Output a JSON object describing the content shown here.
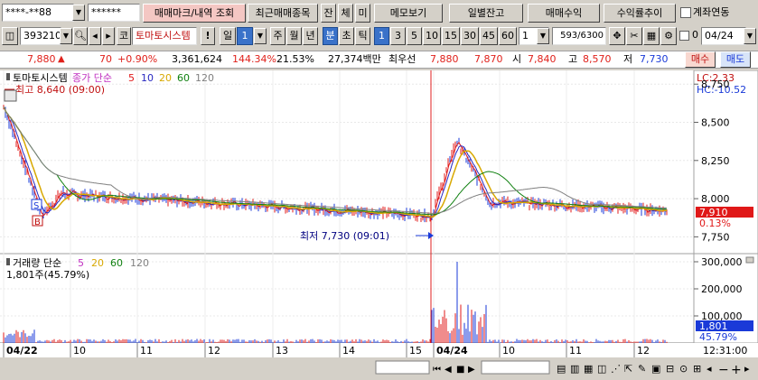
{
  "toolbar": {
    "account": "****-**88",
    "password": "******",
    "btn_order_history": "매매마크/내역 조회",
    "btn_recent_stocks": "최근매매종목",
    "btn_balance": "잔",
    "btn_execution": "체",
    "btn_unfilled": "미",
    "btn_memo": "메모보기",
    "btn_daily_balance": "일별잔고",
    "btn_trade_profit": "매매수익",
    "btn_return_trend": "수익률추이",
    "check_account_link": "계좌연동"
  },
  "chart_toolbar": {
    "code": "393210",
    "market_label": "코",
    "stock_name": "토마토시스템",
    "bang": "!",
    "period_day": "일",
    "period_value": "1",
    "week": "주",
    "month": "월",
    "year": "년",
    "minute": "분",
    "second": "초",
    "tick": "틱",
    "intervals": [
      "1",
      "3",
      "5",
      "10",
      "15",
      "30",
      "45",
      "60"
    ],
    "interval_input": "1",
    "count": "593",
    "count_total": "/6300",
    "checkbox_label": "0",
    "date": "04/24"
  },
  "quote": {
    "price": "7,880",
    "change_arrow": "▲",
    "change": "70",
    "change_pct": "+0.90%",
    "volume": "3,361,624",
    "volume_ratio": "144.34%",
    "turnover": "21.53%",
    "amount": "27,374백만",
    "best_ask_label": "최우선",
    "best_ask": "7,880",
    "best_bid": "7,870",
    "open_label": "시",
    "open": "7,840",
    "high_label": "고",
    "high": "8,570",
    "low_label": "저",
    "low": "7,730",
    "buy_btn": "매수",
    "sell_btn": "매도"
  },
  "chart": {
    "legend_name": "토마토시스템",
    "legend_ma_label": "종가 단순",
    "ma_periods": [
      "5",
      "10",
      "20",
      "60",
      "120"
    ],
    "high_marker": "최고 8,640 (09:00)",
    "low_marker": "최저 7,730 (09:01)",
    "lc": "LC:2.33",
    "hc": "HC:-10.52",
    "current_price": "7,910",
    "current_pct": "0.13%",
    "signal_s": "S",
    "signal_b": "B",
    "volume_legend": "거래량 단순",
    "volume_ma_periods": [
      "5",
      "20",
      "60",
      "120"
    ],
    "volume_value": "1,801주(45.79%)",
    "current_volume": "1,801",
    "current_volume_pct": "45.79%",
    "x_labels": [
      "04/22",
      "10",
      "11",
      "12",
      "13",
      "14",
      "15",
      "04/24",
      "10",
      "11",
      "12"
    ],
    "time_label": "12:31:00"
  },
  "chart_data": {
    "type": "line",
    "price_ticks": [
      7750,
      8000,
      8250,
      8500,
      8750
    ],
    "price_ylim": [
      7640,
      8840
    ],
    "volume_ticks": [
      100000,
      200000,
      300000
    ],
    "volume_ylim": [
      0,
      330000
    ],
    "ma_colors": [
      "#e01818",
      "#2828c0",
      "#d8a800",
      "#108010",
      "#808080"
    ],
    "volume_ma_colors": [
      "#c030c0",
      "#d8a800",
      "#108010",
      "#808080"
    ]
  },
  "colors": {
    "up": "#e0201a",
    "down": "#1a3ad8",
    "accent_blue": "#3a72c9",
    "pink_button": "#f4c7c3"
  }
}
